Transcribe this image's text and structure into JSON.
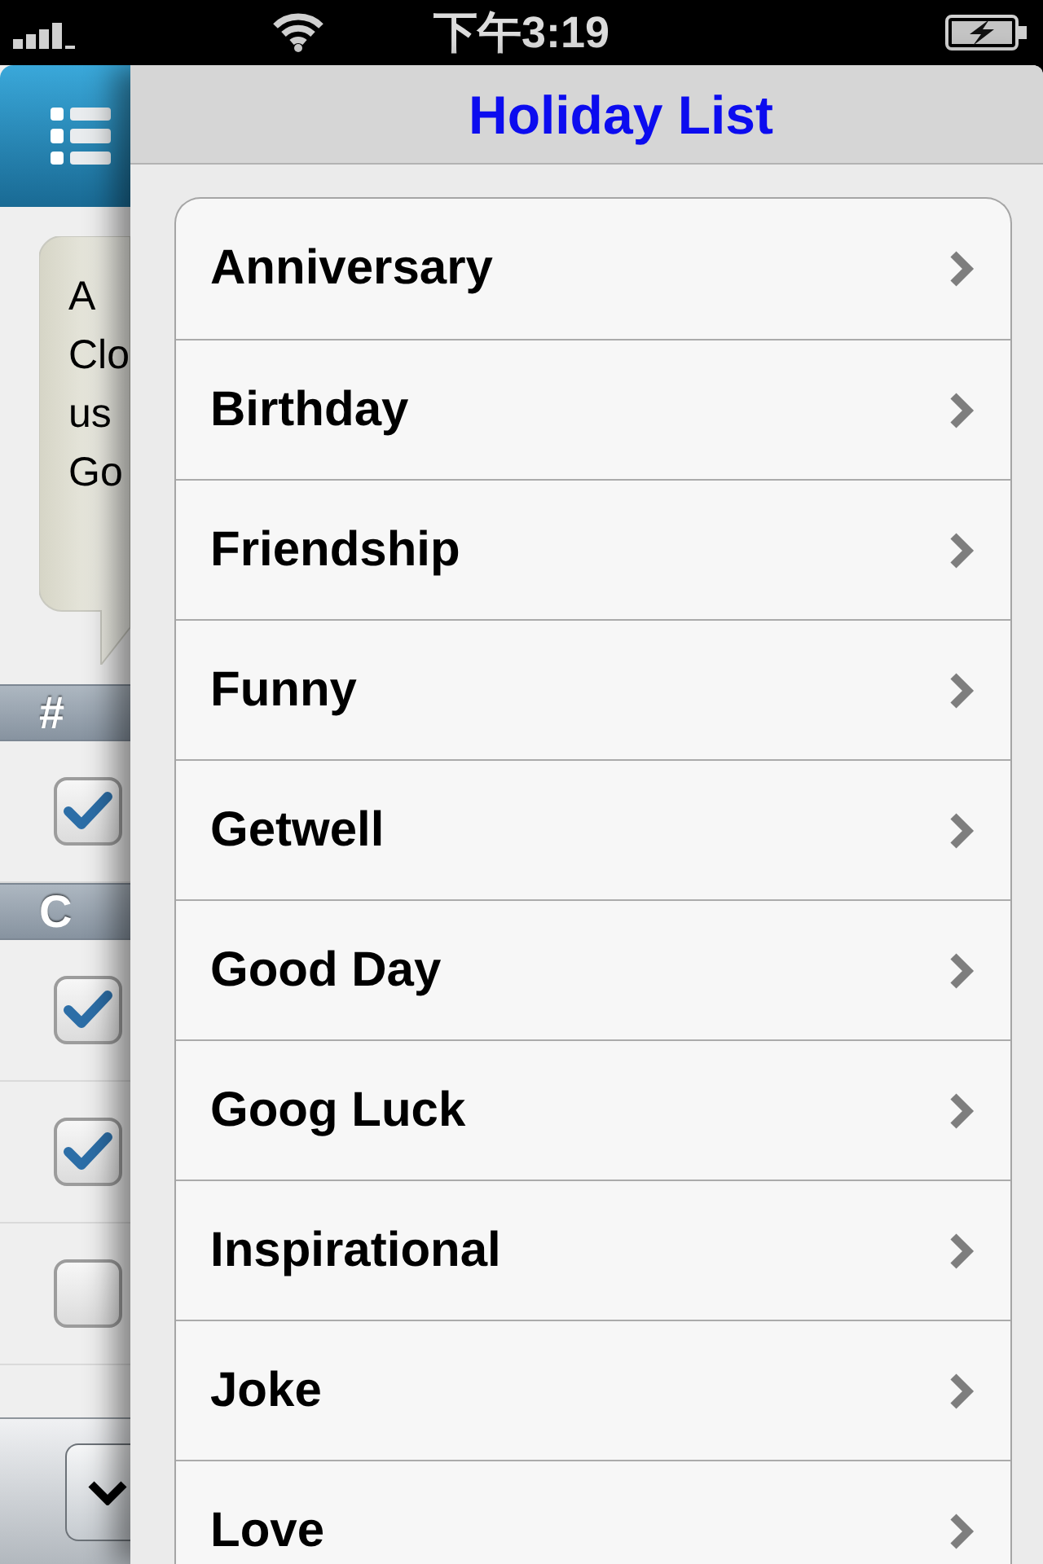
{
  "status_bar": {
    "time": "下午3:19"
  },
  "background_screen": {
    "bubble_lines": [
      "A",
      "Clo",
      "us",
      "Go"
    ],
    "sections": [
      {
        "letter": "#",
        "rows": [
          {
            "checked": true
          }
        ]
      },
      {
        "letter": "C",
        "rows": [
          {
            "checked": true
          },
          {
            "checked": true
          },
          {
            "checked": false
          }
        ]
      }
    ]
  },
  "panel": {
    "title": "Holiday List",
    "items": [
      "Anniversary",
      "Birthday",
      "Friendship",
      "Funny",
      "Getwell",
      "Good Day",
      "Goog Luck",
      "Inspirational",
      "Joke",
      "Love"
    ]
  }
}
